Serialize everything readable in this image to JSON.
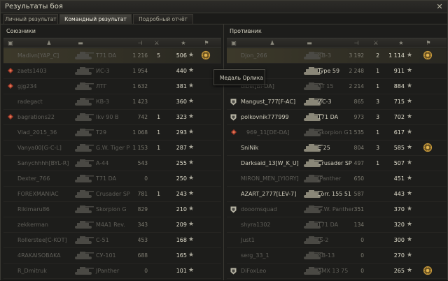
{
  "window": {
    "title": "Результаты боя",
    "close_glyph": "✕"
  },
  "tabs": [
    {
      "label": "Личный результат",
      "active": false
    },
    {
      "label": "Командный результат",
      "active": true
    },
    {
      "label": "Подробный отчёт",
      "active": false
    }
  ],
  "allies": {
    "title": "Союзники",
    "rows": [
      {
        "player": "Madivn[YAP_C]",
        "tank": "T71 DA",
        "damage": "1 216",
        "kills": "5",
        "xp": "506",
        "highlight": true,
        "dead": true,
        "medal": true,
        "clan": false,
        "platoon": false
      },
      {
        "player": "zaets1403",
        "tank": "ИС-3",
        "damage": "1 954",
        "kills": "",
        "xp": "440",
        "highlight": false,
        "dead": true,
        "medal": false,
        "clan": false,
        "platoon": true
      },
      {
        "player": "gjg234",
        "tank": "ЛТГ",
        "damage": "1 632",
        "kills": "",
        "xp": "381",
        "highlight": false,
        "dead": true,
        "medal": false,
        "clan": false,
        "platoon": true
      },
      {
        "player": "radegact",
        "tank": "КВ-3",
        "damage": "1 423",
        "kills": "",
        "xp": "360",
        "highlight": false,
        "dead": true,
        "medal": false,
        "clan": false,
        "platoon": false
      },
      {
        "player": "bagrations22",
        "tank": "Ikv 90 B",
        "damage": "742",
        "kills": "1",
        "xp": "323",
        "highlight": false,
        "dead": true,
        "medal": false,
        "clan": false,
        "platoon": true
      },
      {
        "player": "Vlad_2015_36",
        "tank": "T29",
        "damage": "1 068",
        "kills": "1",
        "xp": "293",
        "highlight": false,
        "dead": true,
        "medal": false,
        "clan": false,
        "platoon": false
      },
      {
        "player": "Vanya00[G-C-L]",
        "tank": "G.W. Tiger P",
        "damage": "1 153",
        "kills": "1",
        "xp": "287",
        "highlight": false,
        "dead": true,
        "medal": false,
        "clan": false,
        "platoon": false
      },
      {
        "player": "Sanychhhh[BYL-R]",
        "tank": "A-44",
        "damage": "543",
        "kills": "",
        "xp": "255",
        "highlight": false,
        "dead": true,
        "medal": false,
        "clan": false,
        "platoon": false
      },
      {
        "player": "Dexter_766",
        "tank": "T71 DA",
        "damage": "0",
        "kills": "",
        "xp": "250",
        "highlight": false,
        "dead": true,
        "medal": false,
        "clan": false,
        "platoon": false
      },
      {
        "player": "FOREXMANIAC",
        "tank": "Crusader SP",
        "damage": "781",
        "kills": "1",
        "xp": "243",
        "highlight": false,
        "dead": true,
        "medal": false,
        "clan": false,
        "platoon": false
      },
      {
        "player": "Rikimaru86",
        "tank": "Skorpion G",
        "damage": "829",
        "kills": "",
        "xp": "210",
        "highlight": false,
        "dead": true,
        "medal": false,
        "clan": false,
        "platoon": false
      },
      {
        "player": "zekkerman",
        "tank": "M4A1 Rev.",
        "damage": "343",
        "kills": "",
        "xp": "209",
        "highlight": false,
        "dead": true,
        "medal": false,
        "clan": false,
        "platoon": false
      },
      {
        "player": "Rollerstee[C-KOT]",
        "tank": "C-51",
        "damage": "453",
        "kills": "",
        "xp": "168",
        "highlight": false,
        "dead": true,
        "medal": false,
        "clan": false,
        "platoon": false
      },
      {
        "player": "4RAKAISOBAKA",
        "tank": "СУ-101",
        "damage": "688",
        "kills": "",
        "xp": "165",
        "highlight": false,
        "dead": true,
        "medal": false,
        "clan": false,
        "platoon": false
      },
      {
        "player": "R_Dmitruk",
        "tank": "JPanther",
        "damage": "0",
        "kills": "",
        "xp": "101",
        "highlight": false,
        "dead": true,
        "medal": false,
        "clan": false,
        "platoon": false
      }
    ]
  },
  "enemies": {
    "title": "Противник",
    "rows": [
      {
        "player": "Djon_266",
        "tank": "КВ-3",
        "damage": "3 192",
        "kills": "2",
        "xp": "1 114",
        "highlight": true,
        "dead": true,
        "medal": true,
        "clan": false,
        "platoon": false
      },
      {
        "player": "",
        "tank": "Type 59",
        "damage": "2 248",
        "kills": "1",
        "xp": "911",
        "highlight": false,
        "dead": false,
        "medal": false,
        "clan": false,
        "platoon": false
      },
      {
        "player": "olbel[BI-DA]",
        "tank": "AT 15",
        "damage": "2 214",
        "kills": "1",
        "xp": "884",
        "highlight": false,
        "dead": true,
        "medal": false,
        "clan": false,
        "platoon": false
      },
      {
        "player": "Mangust_777[F-AC]",
        "tank": "ИС-3",
        "damage": "865",
        "kills": "3",
        "xp": "715",
        "highlight": false,
        "dead": false,
        "medal": false,
        "clan": true,
        "platoon": false
      },
      {
        "player": "polkovnik777999",
        "tank": "T71 DA",
        "damage": "973",
        "kills": "3",
        "xp": "702",
        "highlight": false,
        "dead": false,
        "medal": false,
        "clan": true,
        "platoon": false
      },
      {
        "player": "969_11[DE-DA]",
        "tank": "Skorpion G",
        "damage": "1 535",
        "kills": "1",
        "xp": "617",
        "highlight": false,
        "dead": true,
        "medal": false,
        "clan": false,
        "platoon": true
      },
      {
        "player": "SniNik",
        "tank": "E 25",
        "damage": "804",
        "kills": "3",
        "xp": "585",
        "highlight": false,
        "dead": false,
        "medal": true,
        "clan": false,
        "platoon": false
      },
      {
        "player": "Darksaid_13[W_K_U]",
        "tank": "Crusader SP",
        "damage": "497",
        "kills": "1",
        "xp": "507",
        "highlight": false,
        "dead": false,
        "medal": false,
        "clan": false,
        "platoon": false
      },
      {
        "player": "MIRON_MEN_[YIORY]",
        "tank": "JPanther",
        "damage": "650",
        "kills": "",
        "xp": "451",
        "highlight": false,
        "dead": true,
        "medal": false,
        "clan": false,
        "platoon": false
      },
      {
        "player": "AZART_2777[LEV-7]",
        "tank": "Lorr. 155 51",
        "damage": "587",
        "kills": "",
        "xp": "443",
        "highlight": false,
        "dead": false,
        "medal": false,
        "clan": false,
        "platoon": false
      },
      {
        "player": "dooomsquad",
        "tank": "G.W. Panther",
        "damage": "351",
        "kills": "",
        "xp": "370",
        "highlight": false,
        "dead": true,
        "medal": false,
        "clan": true,
        "platoon": false
      },
      {
        "player": "shyra1302",
        "tank": "T71 DA",
        "damage": "134",
        "kills": "",
        "xp": "320",
        "highlight": false,
        "dead": true,
        "medal": false,
        "clan": false,
        "platoon": false
      },
      {
        "player": "Just1",
        "tank": "IS-2",
        "damage": "0",
        "kills": "",
        "xp": "300",
        "highlight": false,
        "dead": true,
        "medal": false,
        "clan": false,
        "platoon": false
      },
      {
        "player": "serg_33_1",
        "tank": "КВ-13",
        "damage": "0",
        "kills": "",
        "xp": "270",
        "highlight": false,
        "dead": true,
        "medal": false,
        "clan": false,
        "platoon": false
      },
      {
        "player": "DiFoxLeo",
        "tank": "AMX 13 75",
        "damage": "0",
        "kills": "",
        "xp": "265",
        "highlight": false,
        "dead": true,
        "medal": true,
        "clan": true,
        "platoon": false
      }
    ]
  },
  "tooltip": {
    "text": "Медаль Орлика"
  },
  "icons": {
    "star": "★",
    "medal": "medal-icon",
    "platoon": "platoon-icon",
    "clan": "clan-icon",
    "tank": "tank-icon"
  },
  "colors": {
    "highlight": "#7a6e46",
    "medal": "#c89a3c"
  }
}
